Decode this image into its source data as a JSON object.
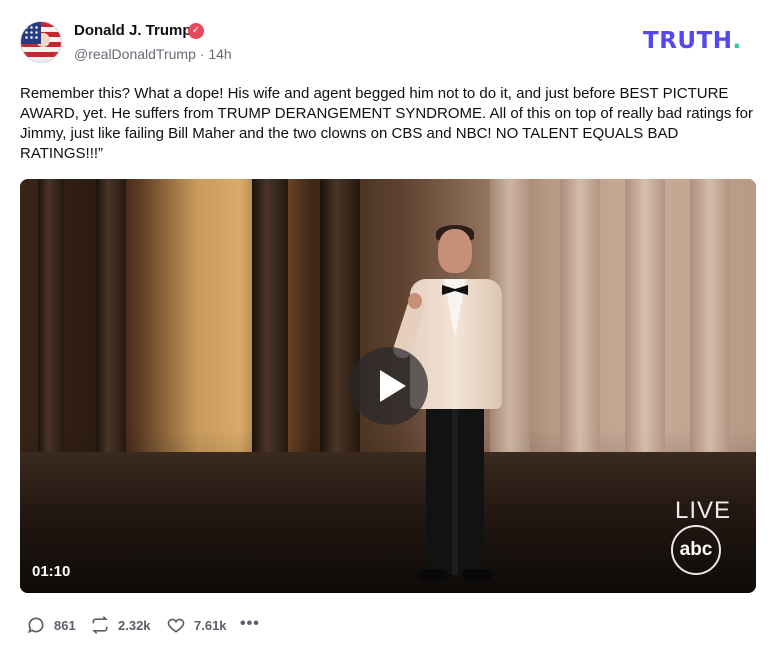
{
  "author": {
    "name": "Donald J. Trump",
    "handle": "@realDonaldTrump",
    "time": "14h",
    "verified_color": "#e34a5b"
  },
  "brand": {
    "logo_text": "TRUTH",
    "logo_dot": ".",
    "color": "#5448ee",
    "dot_color": "#1fd1a6"
  },
  "post": {
    "text": "Remember this? What a dope! His wife and agent begged him not to do it, and just before BEST PICTURE AWARD, yet. He suffers from TRUMP DERANGEMENT SYNDROME. All of this on top of really bad ratings for Jimmy, just like failing Bill Maher and the two clowns on CBS and NBC! NO TALENT EQUALS BAD RATINGS!!!”"
  },
  "video": {
    "duration": "01:10",
    "live_label": "LIVE",
    "network_logo": "abc",
    "play_icon": "play-icon"
  },
  "actions": {
    "replies": "861",
    "retruths": "2.32k",
    "likes": "7.61k",
    "more": "•••"
  }
}
